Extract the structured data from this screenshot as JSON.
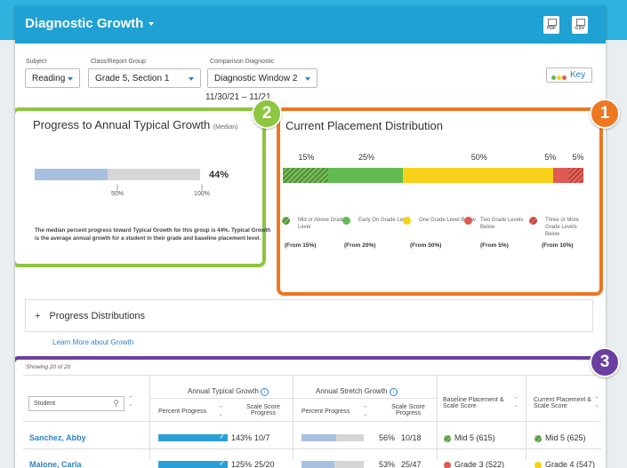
{
  "header": {
    "title": "Diagnostic Growth",
    "pdf_label": "PDF",
    "csv_label": "CSV"
  },
  "filters": {
    "subject_label": "Subject",
    "subject_value": "Reading",
    "group_label": "Class/Report Group",
    "group_value": "Grade 5, Section 1",
    "comparison_label": "Comparison Diagnostic",
    "comparison_value": "Diagnostic Window 2",
    "date_range": "11/30/21 – 11/21"
  },
  "key_label": "Key",
  "colors": {
    "green": "#5cb85c",
    "yellow": "#f5d51a",
    "red": "#e05a55",
    "accent_orange": "#ee7722",
    "accent_green": "#8dc63f",
    "accent_purple": "#6b3fa0",
    "brand_blue": "#1fa1d3"
  },
  "badges": {
    "b1": "1",
    "b2": "2",
    "b3": "3"
  },
  "progress": {
    "title": "Progress to Annual Typical Growth",
    "title_suffix": "(Median)",
    "percent_label": "44%",
    "percent_value": 44,
    "tick_50": "50%",
    "tick_100": "100%",
    "note": "The median percent progress toward Typical Growth for this group is 44%. Typical Growth is the average annual growth for a student in their grade and baseline placement level."
  },
  "placement": {
    "title": "Current Placement Distribution",
    "segments": [
      {
        "label": "15%",
        "value": 15,
        "color": "hatch-green"
      },
      {
        "label": "25%",
        "value": 25,
        "color": "#62bb50"
      },
      {
        "label": "50%",
        "value": 50,
        "color": "#f8d21a"
      },
      {
        "label": "5%",
        "value": 5,
        "color": "#e05a55"
      },
      {
        "label": "5%",
        "value": 5,
        "color": "hatch-red"
      }
    ],
    "legend": [
      {
        "label": "Mid or Above Grade Level",
        "from": "(From 15%)"
      },
      {
        "label": "Early On Grade Level",
        "from": "(From 20%)"
      },
      {
        "label": "One Grade Level Below",
        "from": "(From 50%)"
      },
      {
        "label": "Two Grade Levels Below",
        "from": "(From 5%)"
      },
      {
        "label": "Three or More Grade Levels Below",
        "from": "(From 10%)"
      }
    ]
  },
  "expander": {
    "icon": "+",
    "label": "Progress Distributions"
  },
  "learn_more": "Learn More about Growth",
  "table": {
    "showing": "Showing 20 of 20",
    "student_placeholder": "Student",
    "group_typical": "Annual Typical Growth",
    "group_stretch": "Annual Stretch Growth",
    "col_percent_progress": "Percent Progress",
    "col_scale_score_progress": "Scale Score Progress",
    "col_baseline": "Baseline Placement & Scale Score",
    "col_current": "Current Placement & Scale Score",
    "rows": [
      {
        "name": "Sanchez, Abby",
        "typ_pct": "143%",
        "typ_pct_value": 143,
        "typ_ss": "10/7",
        "str_pct": "56%",
        "str_pct_value": 56,
        "str_ss": "10/18",
        "baseline": "Mid 5 (615)",
        "baseline_color": "hatch-green",
        "current": "Mid 5 (625)",
        "current_color": "hatch-green"
      },
      {
        "name": "Malone, Carla",
        "typ_pct": "125%",
        "typ_pct_value": 125,
        "typ_ss": "25/20",
        "str_pct": "53%",
        "str_pct_value": 53,
        "str_ss": "25/47",
        "baseline": "Grade 3 (522)",
        "baseline_color": "#e05a55",
        "current": "Grade 4 (547)",
        "current_color": "#f8d21a"
      }
    ]
  }
}
